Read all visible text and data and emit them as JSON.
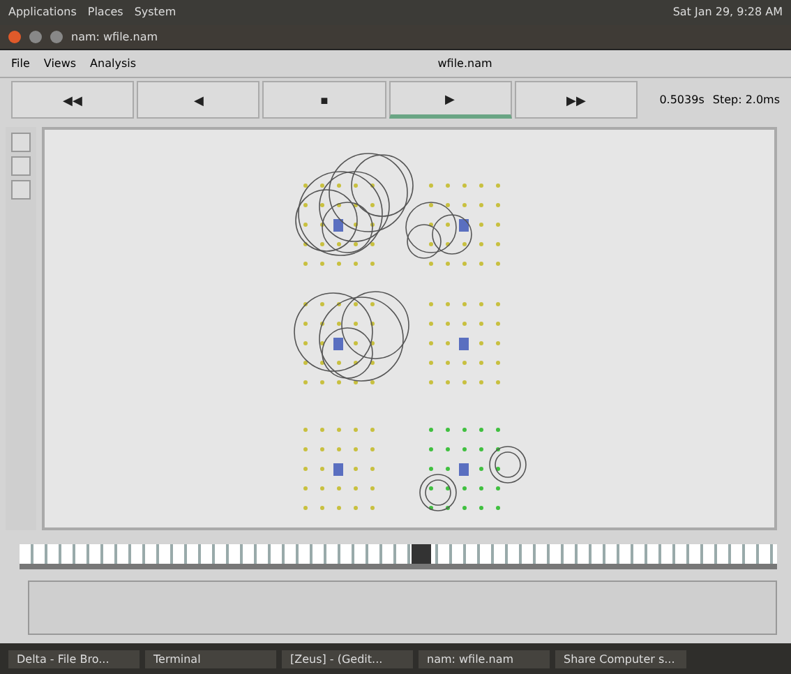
{
  "top_panel": {
    "menus": [
      "Applications",
      "Places",
      "System"
    ],
    "clock": "Sat Jan 29, 9:28 AM"
  },
  "window": {
    "title": "nam: wfile.nam"
  },
  "menu_bar": {
    "items": [
      "File",
      "Views",
      "Analysis"
    ],
    "file_name": "wfile.nam"
  },
  "controls": [
    {
      "symbol": "◀◀",
      "selected": false
    },
    {
      "symbol": "◀",
      "selected": false
    },
    {
      "symbol": "■",
      "selected": false
    },
    {
      "symbol": "▶",
      "selected": true
    },
    {
      "symbol": "▶▶",
      "selected": false
    }
  ],
  "time": "0.5039s",
  "step": "Step: 2.0ms",
  "timeline": {
    "level": 0.53
  },
  "taskbar": [
    "Delta - File Bro...",
    "Terminal",
    "[Zeus] - (Gedit...",
    "nam: wfile.nam",
    "Share Computer s..."
  ]
}
